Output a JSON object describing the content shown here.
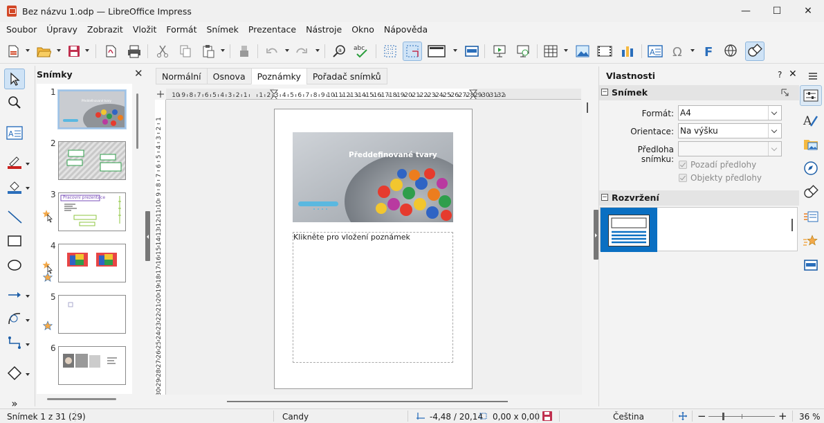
{
  "window": {
    "title": "Bez názvu 1.odp — LibreOffice Impress",
    "minimize": "—",
    "maximize": "☐",
    "close": "✕"
  },
  "menu": [
    "Soubor",
    "Úpravy",
    "Zobrazit",
    "Vložit",
    "Formát",
    "Snímek",
    "Prezentace",
    "Nástroje",
    "Okno",
    "Nápověda"
  ],
  "toolbar_icons": [
    "new-icon",
    "open-icon",
    "save-icon",
    "export-pdf-icon",
    "print-icon",
    "cut-icon",
    "copy-icon",
    "paste-icon",
    "clone-formatting-icon",
    "undo-icon",
    "redo-icon",
    "find-replace-icon",
    "spelling-icon",
    "grid-icon",
    "snap-guides-icon",
    "display-views-icon",
    "master-slide-icon",
    "start-first-icon",
    "start-current-icon",
    "table-icon",
    "image-icon",
    "media-icon",
    "chart-icon",
    "textbox-icon",
    "special-char-icon",
    "fontwork-icon",
    "hyperlink-icon",
    "shapes-icon"
  ],
  "slide_panel": {
    "title": "Snímky",
    "close": "✕",
    "slides": [
      {
        "num": "1",
        "caption": "Předdefinované tvary"
      },
      {
        "num": "2",
        "caption": ""
      },
      {
        "num": "3",
        "caption": "Pracovní prezentace"
      },
      {
        "num": "4",
        "caption": ""
      },
      {
        "num": "5",
        "caption": ""
      },
      {
        "num": "6",
        "caption": ""
      }
    ]
  },
  "view_tabs": [
    "Normální",
    "Osnova",
    "Poznámky",
    "Pořadač snímků"
  ],
  "active_view_tab": "Poznámky",
  "hruler_numbers": [
    "10",
    "9",
    "8",
    "7",
    "6",
    "5",
    "4",
    "3",
    "2",
    "1",
    "",
    "1",
    "2",
    "3",
    "4",
    "5",
    "6",
    "7",
    "8",
    "9",
    "10",
    "11",
    "12",
    "13",
    "14",
    "15",
    "16",
    "17",
    "18",
    "19",
    "20",
    "21",
    "22",
    "23",
    "24",
    "25",
    "26",
    "27",
    "28",
    "29",
    "30",
    "31",
    "32"
  ],
  "vruler_numbers": [
    "1",
    "2",
    "3",
    "4",
    "5",
    "6",
    "7",
    "8",
    "9",
    "10",
    "11",
    "12",
    "13",
    "14",
    "15",
    "16",
    "17",
    "18",
    "19",
    "20",
    "21",
    "22",
    "23",
    "24",
    "25",
    "26",
    "27",
    "28",
    "29",
    "30"
  ],
  "page": {
    "slide_title": "Předdefinované tvary",
    "notes_placeholder": "Klikněte pro vložení poznámek"
  },
  "sidebar": {
    "title": "Vlastnosti",
    "help": "?",
    "close": "✕",
    "section_slide": "Snímek",
    "format_label": "Formát:",
    "format_value": "A4",
    "orientation_label": "Orientace:",
    "orientation_value": "Na výšku",
    "master_label": "Předloha snímku:",
    "master_value": "",
    "master_bg_label": "Pozadí předlohy",
    "master_obj_label": "Objekty předlohy",
    "section_layout": "Rozvržení"
  },
  "sidebar_tabs": [
    "properties-icon",
    "styles-icon",
    "gallery-icon",
    "navigator-icon",
    "shapes-icon",
    "slide-transition-icon",
    "animation-icon",
    "master-slides-icon"
  ],
  "status": {
    "slide": "Snímek 1 z 31 (29)",
    "master": "Candy",
    "position": "-4,48 / 20,14",
    "size": "0,00 x 0,00",
    "language": "Čeština",
    "zoom_minus": "−",
    "zoom_plus": "+",
    "zoom_percent": 36,
    "zoom": "36 %"
  },
  "colors": {
    "accent": "#0a6fc2",
    "font_color": "#c9211e",
    "highlight": "#2a6ebb"
  }
}
